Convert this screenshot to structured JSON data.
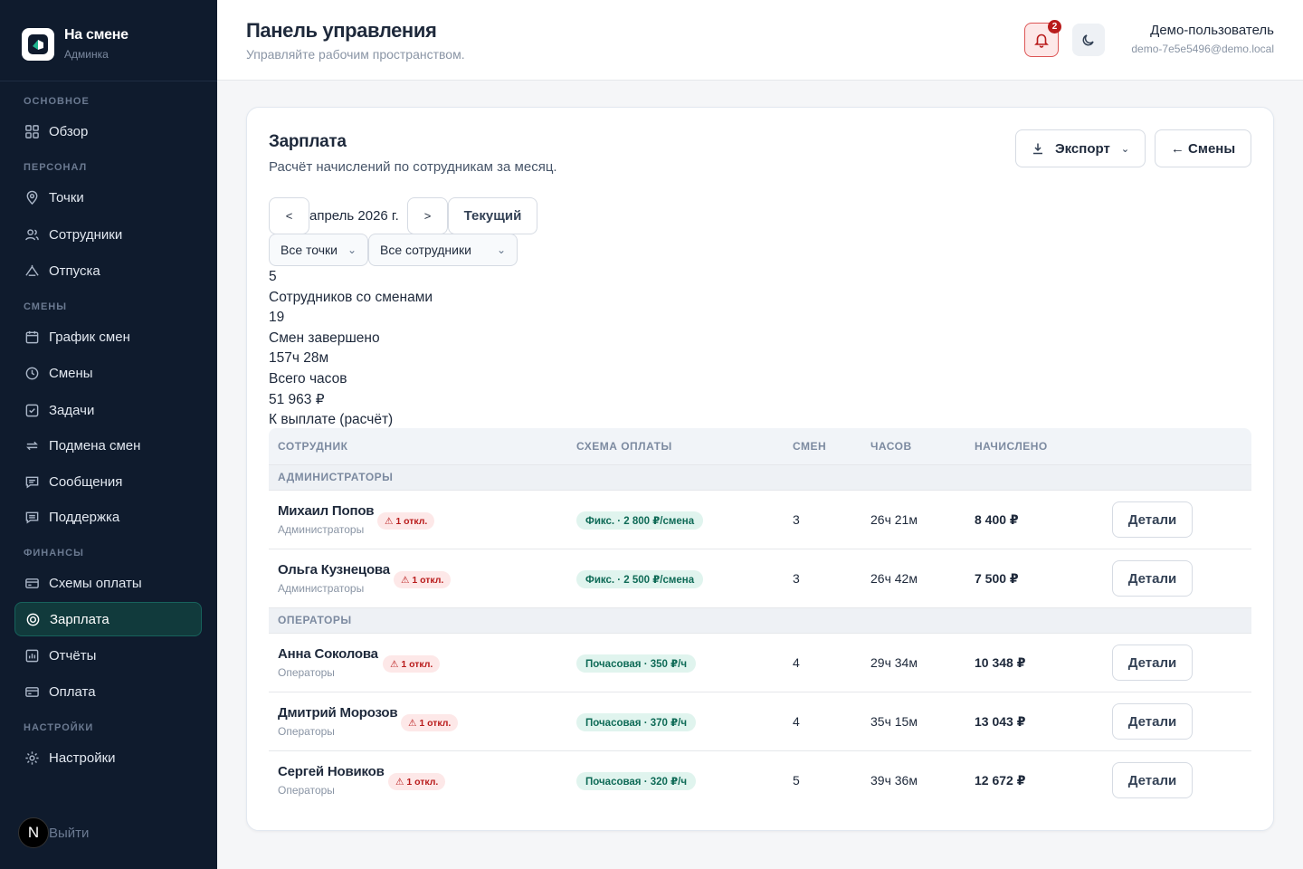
{
  "brand": {
    "name": "На смене",
    "sub": "Админка"
  },
  "sidebar": {
    "sections": [
      {
        "label": "ОСНОВНОЕ"
      },
      {
        "label": "ПЕРСОНАЛ"
      },
      {
        "label": "СМЕНЫ"
      },
      {
        "label": "ФИНАНСЫ"
      },
      {
        "label": "НАСТРОЙКИ"
      }
    ],
    "items": [
      {
        "label": "Обзор",
        "icon": "grid-icon"
      },
      {
        "label": "Точки",
        "icon": "map-pin-icon"
      },
      {
        "label": "Сотрудники",
        "icon": "users-icon"
      },
      {
        "label": "Отпуска",
        "icon": "umbrella-icon"
      },
      {
        "label": "График смен",
        "icon": "calendar-icon"
      },
      {
        "label": "Смены",
        "icon": "clock-icon"
      },
      {
        "label": "Задачи",
        "icon": "checkbox-icon"
      },
      {
        "label": "Подмена смен",
        "icon": "swap-icon"
      },
      {
        "label": "Сообщения",
        "icon": "message-icon"
      },
      {
        "label": "Поддержка",
        "icon": "support-icon"
      },
      {
        "label": "Схемы оплаты",
        "icon": "card-icon"
      },
      {
        "label": "Зарплата",
        "icon": "coin-icon",
        "active": true
      },
      {
        "label": "Отчёты",
        "icon": "chart-icon"
      },
      {
        "label": "Оплата",
        "icon": "wallet-icon"
      },
      {
        "label": "Настройки",
        "icon": "gear-icon"
      }
    ],
    "logout": {
      "avatar": "N",
      "label": "Выйти"
    }
  },
  "header": {
    "title": "Панель управления",
    "subtitle": "Управляйте рабочим пространством.",
    "notifications_count": "2",
    "user_name": "Демо-пользователь",
    "user_email": "demo-7e5e5496@demo.local"
  },
  "card": {
    "title": "Зарплата",
    "subtitle": "Расчёт начислений по сотрудникам за месяц.",
    "export_label": "Экспорт",
    "shifts_label": "← Смены",
    "prev": "<",
    "next": ">",
    "month": "апрель 2026 г.",
    "current_label": "Текущий",
    "filter_points": "Все точки",
    "filter_employees": "Все сотрудники"
  },
  "stats": [
    {
      "value": "5",
      "label": "Сотрудников со сменами"
    },
    {
      "value": "19",
      "label": "Смен завершено"
    },
    {
      "value": "157ч 28м",
      "label": "Всего часов"
    },
    {
      "value": "51 963 ₽",
      "label": "К выплате (расчёт)"
    }
  ],
  "table": {
    "headers": [
      "СОТРУДНИК",
      "СХЕМА ОПЛАТЫ",
      "СМЕН",
      "ЧАСОВ",
      "НАЧИСЛЕНО"
    ],
    "details_label": "Детали",
    "groups": [
      {
        "name": "АДМИНИСТРАТОРЫ",
        "rows": [
          {
            "name": "Михаил Попов",
            "group": "Администраторы",
            "warn": "⚠ 1 откл.",
            "scheme": "Фикс. · 2 800 ₽/смена",
            "shifts": "3",
            "hours": "26ч 21м",
            "accrued": "8 400 ₽"
          },
          {
            "name": "Ольга Кузнецова",
            "group": "Администраторы",
            "warn": "⚠ 1 откл.",
            "scheme": "Фикс. · 2 500 ₽/смена",
            "shifts": "3",
            "hours": "26ч 42м",
            "accrued": "7 500 ₽"
          }
        ]
      },
      {
        "name": "ОПЕРАТОРЫ",
        "rows": [
          {
            "name": "Анна Соколова",
            "group": "Операторы",
            "warn": "⚠ 1 откл.",
            "scheme": "Почасовая · 350 ₽/ч",
            "shifts": "4",
            "hours": "29ч 34м",
            "accrued": "10 348 ₽"
          },
          {
            "name": "Дмитрий Морозов",
            "group": "Операторы",
            "warn": "⚠ 1 откл.",
            "scheme": "Почасовая · 370 ₽/ч",
            "shifts": "4",
            "hours": "35ч 15м",
            "accrued": "13 043 ₽"
          },
          {
            "name": "Сергей Новиков",
            "group": "Операторы",
            "warn": "⚠ 1 откл.",
            "scheme": "Почасовая · 320 ₽/ч",
            "shifts": "5",
            "hours": "39ч 36м",
            "accrued": "12 672 ₽"
          }
        ]
      }
    ]
  }
}
